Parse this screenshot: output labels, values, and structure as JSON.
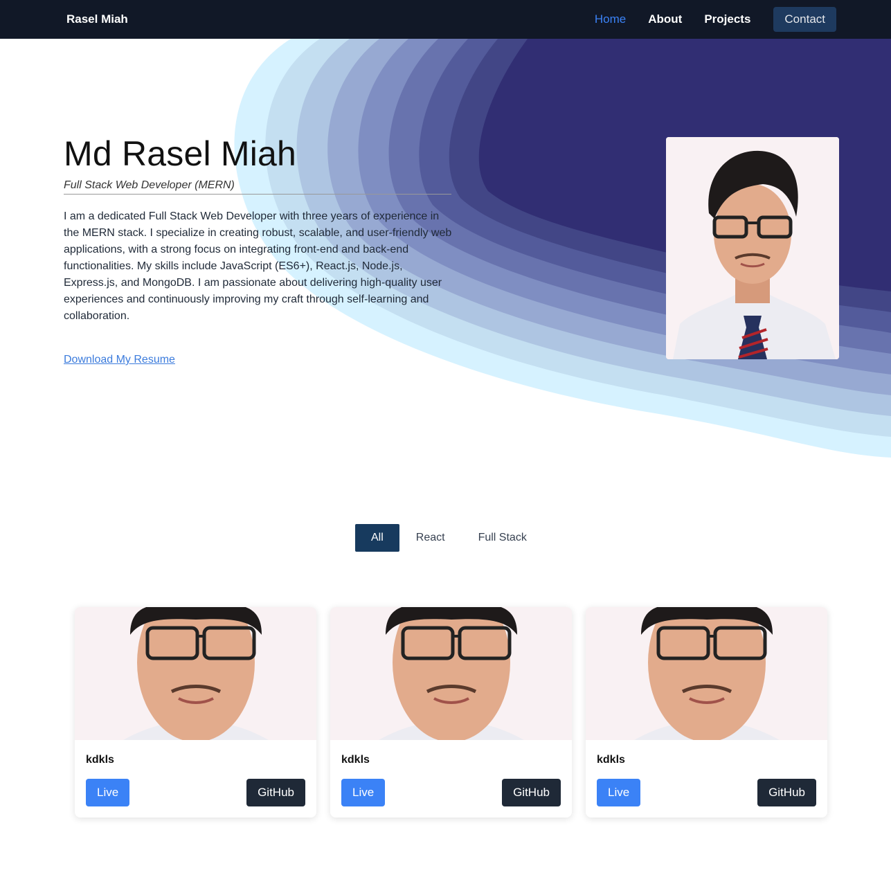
{
  "navbar": {
    "brand": "Rasel Miah",
    "links": [
      "Home",
      "About",
      "Projects"
    ],
    "active": "Home",
    "contact_label": "Contact"
  },
  "hero": {
    "name": "Md Rasel Miah",
    "subtitle": "Full Stack Web Developer (MERN)",
    "description": "I am a dedicated Full Stack Web Developer with three years of experience in the MERN stack. I specialize in creating robust, scalable, and user-friendly web applications, with a strong focus on integrating front-end and back-end functionalities. My skills include JavaScript (ES6+), React.js, Node.js, Express.js, and MongoDB. I am passionate about delivering high-quality user experiences and continuously improving my craft through self-learning and collaboration.",
    "resume_link": "Download My Resume"
  },
  "filters": {
    "items": [
      "All",
      "React",
      "Full Stack"
    ],
    "active": "All"
  },
  "projects": [
    {
      "title": "kdkls",
      "live_label": "Live",
      "github_label": "GitHub"
    },
    {
      "title": "kdkls",
      "live_label": "Live",
      "github_label": "GitHub"
    },
    {
      "title": "kdkls",
      "live_label": "Live",
      "github_label": "GitHub"
    }
  ],
  "colors": {
    "navbar_bg": "#111827",
    "accent": "#3b82f6",
    "contact_bg": "#1e3a5f",
    "filter_active_bg": "#173a5e",
    "github_bg": "#1f2937",
    "wave_dark": "#312e73",
    "wave_light": "#d6f2ff"
  }
}
